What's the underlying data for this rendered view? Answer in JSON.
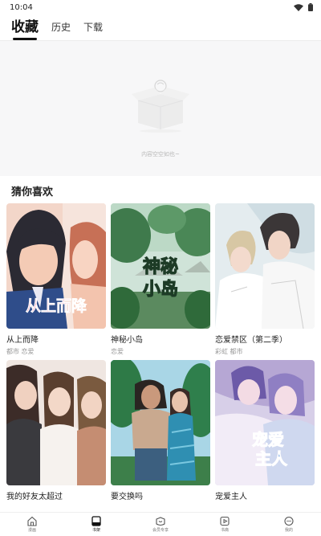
{
  "status_bar": {
    "time": "10:04"
  },
  "tabs": [
    {
      "label": "收藏"
    },
    {
      "label": "历史"
    },
    {
      "label": "下载"
    }
  ],
  "empty_state": {
    "text": "内容空空如也~"
  },
  "section": {
    "title": "猜你喜欢"
  },
  "cards": [
    {
      "title": "从上而降",
      "tags": "都市 恋爱",
      "cover_text": "从上而降"
    },
    {
      "title": "神秘小岛",
      "tags": "恋爱",
      "cover_text_line1": "神秘",
      "cover_text_line2": "小岛"
    },
    {
      "title": "恋爱禁区（第二季）",
      "tags": "彩虹 都市"
    },
    {
      "title": "我的好友太超过",
      "tags": ""
    },
    {
      "title": "要交换吗",
      "tags": ""
    },
    {
      "title": "宠爱主人",
      "tags": "",
      "cover_text_line1": "宠爱",
      "cover_text_line2": "主人"
    }
  ],
  "bottom_nav": [
    {
      "label": "漫画",
      "icon": "home-icon"
    },
    {
      "label": "书架",
      "icon": "bookshelf-icon"
    },
    {
      "label": "会员专享",
      "icon": "vip-icon"
    },
    {
      "label": "书斋",
      "icon": "play-icon"
    },
    {
      "label": "我的",
      "icon": "profile-icon"
    }
  ],
  "colors": {
    "accent": "#111111",
    "empty_bg": "#f7f7f8"
  }
}
